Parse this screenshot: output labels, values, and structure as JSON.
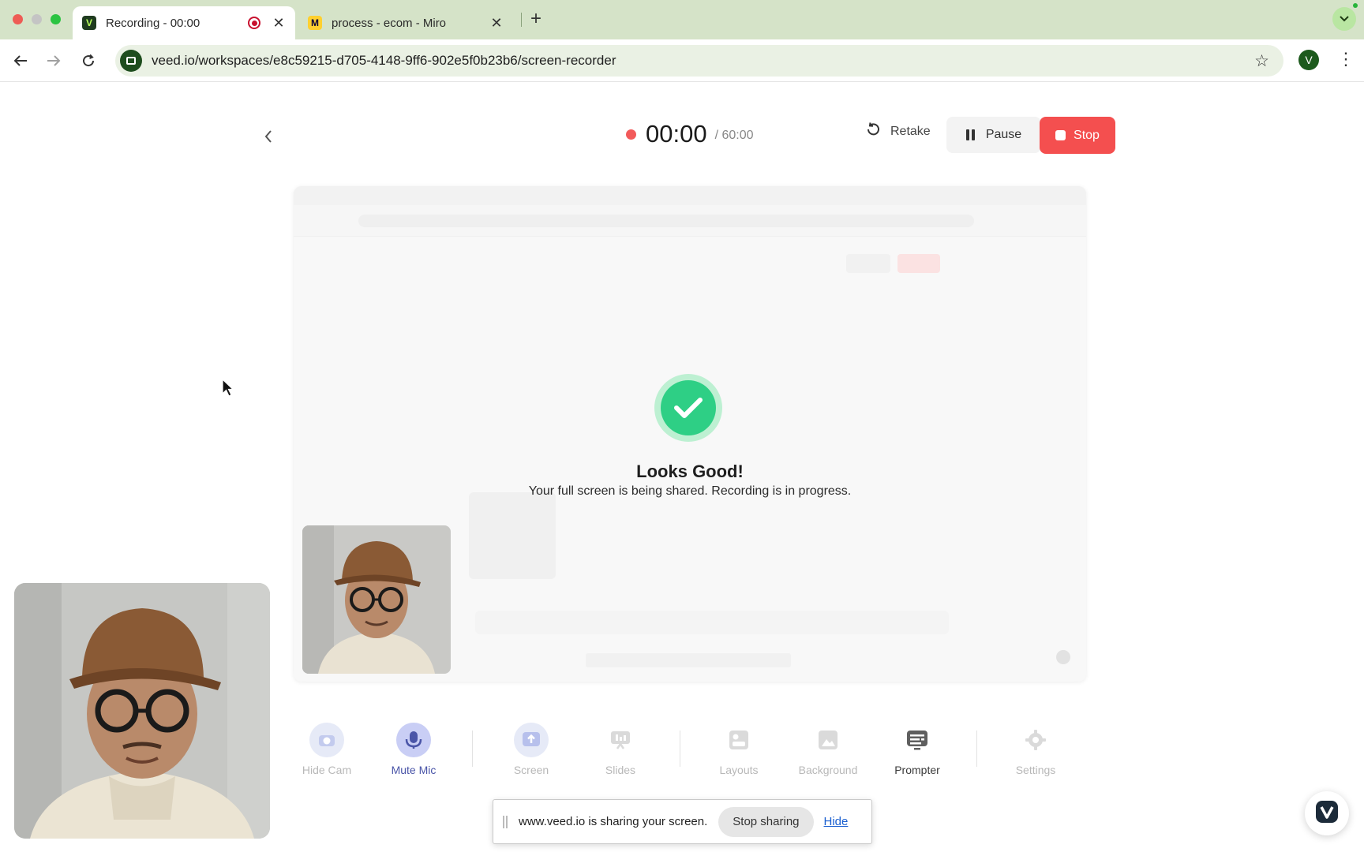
{
  "browser": {
    "tabs": [
      {
        "title": "Recording - 00:00",
        "favicon": "veed-logo-icon",
        "active": true
      },
      {
        "title": "process - ecom - Miro",
        "favicon": "miro-logo-icon",
        "active": false
      }
    ],
    "url_host": "veed.io",
    "url_path": "/workspaces/e8c59215-d705-4148-9ff6-902e5f0b23b6/screen-recorder",
    "profile_initial": "V"
  },
  "recorder": {
    "timer": "00:00",
    "max_time": "/ 60:00",
    "retake_label": "Retake",
    "pause_label": "Pause",
    "stop_label": "Stop",
    "stop_color": "#f44f4f"
  },
  "preview": {
    "status_title": "Looks Good!",
    "status_message": "Your full screen is being shared. Recording is in progress.",
    "success_color": "#2ecf85"
  },
  "toolbar": {
    "hide_cam": "Hide Cam",
    "mute_mic": "Mute Mic",
    "screen": "Screen",
    "slides": "Slides",
    "layouts": "Layouts",
    "background": "Background",
    "prompter": "Prompter",
    "settings": "Settings"
  },
  "share_banner": {
    "message": "www.veed.io is sharing your screen.",
    "stop_label": "Stop sharing",
    "hide_label": "Hide"
  }
}
